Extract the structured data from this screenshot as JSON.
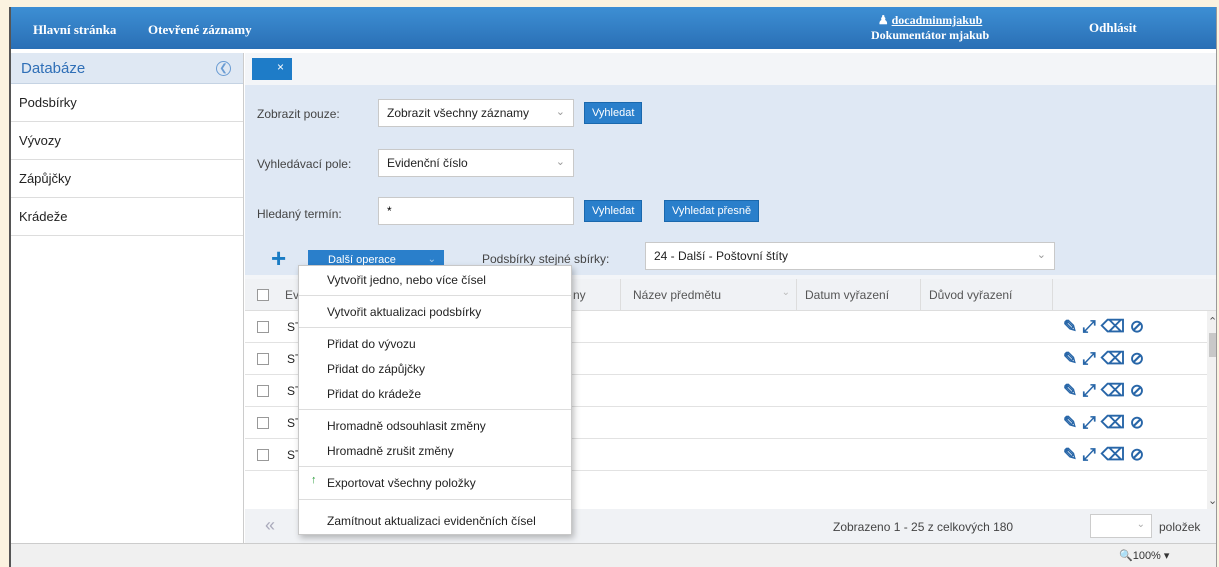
{
  "topbar": {
    "nav": [
      "Hlavní stránka",
      "Otevřené záznamy"
    ],
    "user_name": "docadminmjakub",
    "user_role": "Dokumentátor mjakub",
    "logout": "Odhlásit"
  },
  "sidebar": {
    "title": "Databáze",
    "items": [
      "Podsbírky",
      "Vývozy",
      "Zápůjčky",
      "Krádeže"
    ]
  },
  "filter": {
    "close_label": "×",
    "show_only_label": "Zobrazit pouze:",
    "show_only_value": "Zobrazit všechny záznamy",
    "search_btn": "Vyhledat",
    "search_field_label": "Vyhledávací pole:",
    "search_field_value": "Evidenční číslo",
    "term_label": "Hledaný termín:",
    "term_value": "*",
    "search_btn2": "Vyhledat",
    "search_exact_btn": "Vyhledat přesně"
  },
  "toolbar": {
    "add_icon": "+",
    "more_ops": "Další operace",
    "subcoll_label": "Podsbírky stejné sbírky:",
    "subcoll_value": "24 - Další - Poštovní štíty"
  },
  "table": {
    "columns": [
      "Evi",
      "ny",
      "Název předmětu",
      "Datum vyřazení",
      "Důvod vyřazení"
    ],
    "rows": [
      "ST9",
      "ST9",
      "ST9",
      "ST9",
      "ST9"
    ]
  },
  "footer": {
    "summary": "Zobrazeno 1 - 25 z celkových 180",
    "items_label": "položek"
  },
  "statusbar": {
    "zoom": "100%"
  },
  "menu": {
    "items": [
      "Vytvořit jedno, nebo více čísel",
      "Vytvořit aktualizaci podsbírky",
      "Přidat do vývozu",
      "Přidat do zápůjčky",
      "Přidat do krádeže",
      "Hromadně odsouhlasit změny",
      "Hromadně zrušit změny",
      "Exportovat všechny položky",
      "Zamítnout aktualizaci evidenčních čísel"
    ]
  }
}
